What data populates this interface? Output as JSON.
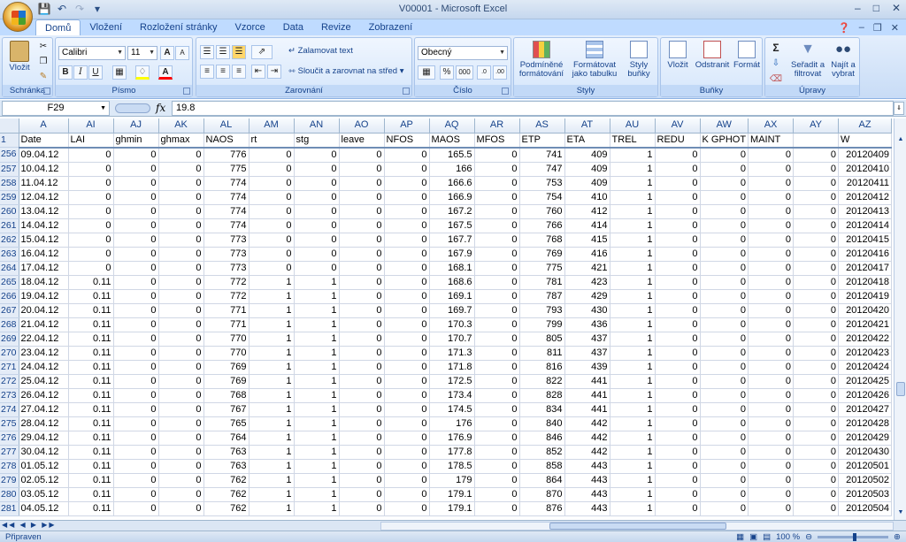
{
  "window": {
    "title": "V00001 - Microsoft Excel"
  },
  "quick_access": {
    "icons": [
      "save-icon",
      "undo-icon",
      "redo-icon",
      "customize-icon"
    ]
  },
  "tabs": [
    {
      "label": "Domů",
      "active": true
    },
    {
      "label": "Vložení"
    },
    {
      "label": "Rozložení stránky"
    },
    {
      "label": "Vzorce"
    },
    {
      "label": "Data"
    },
    {
      "label": "Revize"
    },
    {
      "label": "Zobrazení"
    }
  ],
  "ribbon": {
    "clipboard": {
      "label": "Schránka",
      "paste": "Vložit"
    },
    "font": {
      "label": "Písmo",
      "name": "Calibri",
      "size": "11",
      "bold": "B",
      "italic": "I",
      "underline": "U",
      "grow": "A",
      "shrink": "A"
    },
    "alignment": {
      "label": "Zarovnání",
      "wrap": "Zalamovat text",
      "merge": "Sloučit a zarovnat na střed"
    },
    "number": {
      "label": "Číslo",
      "format": "Obecný",
      "percent": "%",
      "thousands": "000"
    },
    "styles": {
      "label": "Styly",
      "conditional": "Podmíněné formátování",
      "as_table": "Formátovat jako tabulku",
      "cell_styles": "Styly buňky"
    },
    "cells": {
      "label": "Buňky",
      "insert": "Vložit",
      "delete": "Odstranit",
      "format": "Formát"
    },
    "editing": {
      "label": "Úpravy",
      "sigma": "Σ",
      "sort": "Seřadit a filtrovat",
      "find": "Najít a vybrat"
    }
  },
  "formula_bar": {
    "name_box": "F29",
    "fx": "fx",
    "value": "19.8"
  },
  "columns": [
    "A",
    "AI",
    "AJ",
    "AK",
    "AL",
    "AM",
    "AN",
    "AO",
    "AP",
    "AQ",
    "AR",
    "AS",
    "AT",
    "AU",
    "AV",
    "AW",
    "AX",
    "AY",
    "AZ"
  ],
  "header_row": {
    "num": "1",
    "cells": [
      "Date",
      "LAI",
      "ghmin",
      "ghmax",
      "NAOS",
      "rt",
      "stg",
      "leave",
      "NFOS",
      "MAOS",
      "MFOS",
      "ETP",
      "ETA",
      "TREL",
      "REDU",
      "K GPHOT",
      "MAINT",
      "",
      "W"
    ]
  },
  "rows": [
    {
      "num": "256",
      "cells": [
        "09.04.12",
        "0",
        "0",
        "0",
        "776",
        "0",
        "0",
        "0",
        "0",
        "165.5",
        "0",
        "741",
        "409",
        "1",
        "0",
        "0",
        "0",
        "0",
        "20120409"
      ]
    },
    {
      "num": "257",
      "cells": [
        "10.04.12",
        "0",
        "0",
        "0",
        "775",
        "0",
        "0",
        "0",
        "0",
        "166",
        "0",
        "747",
        "409",
        "1",
        "0",
        "0",
        "0",
        "0",
        "20120410"
      ]
    },
    {
      "num": "258",
      "cells": [
        "11.04.12",
        "0",
        "0",
        "0",
        "774",
        "0",
        "0",
        "0",
        "0",
        "166.6",
        "0",
        "753",
        "409",
        "1",
        "0",
        "0",
        "0",
        "0",
        "20120411"
      ]
    },
    {
      "num": "259",
      "cells": [
        "12.04.12",
        "0",
        "0",
        "0",
        "774",
        "0",
        "0",
        "0",
        "0",
        "166.9",
        "0",
        "754",
        "410",
        "1",
        "0",
        "0",
        "0",
        "0",
        "20120412"
      ]
    },
    {
      "num": "260",
      "cells": [
        "13.04.12",
        "0",
        "0",
        "0",
        "774",
        "0",
        "0",
        "0",
        "0",
        "167.2",
        "0",
        "760",
        "412",
        "1",
        "0",
        "0",
        "0",
        "0",
        "20120413"
      ]
    },
    {
      "num": "261",
      "cells": [
        "14.04.12",
        "0",
        "0",
        "0",
        "774",
        "0",
        "0",
        "0",
        "0",
        "167.5",
        "0",
        "766",
        "414",
        "1",
        "0",
        "0",
        "0",
        "0",
        "20120414"
      ]
    },
    {
      "num": "262",
      "cells": [
        "15.04.12",
        "0",
        "0",
        "0",
        "773",
        "0",
        "0",
        "0",
        "0",
        "167.7",
        "0",
        "768",
        "415",
        "1",
        "0",
        "0",
        "0",
        "0",
        "20120415"
      ]
    },
    {
      "num": "263",
      "cells": [
        "16.04.12",
        "0",
        "0",
        "0",
        "773",
        "0",
        "0",
        "0",
        "0",
        "167.9",
        "0",
        "769",
        "416",
        "1",
        "0",
        "0",
        "0",
        "0",
        "20120416"
      ]
    },
    {
      "num": "264",
      "cells": [
        "17.04.12",
        "0",
        "0",
        "0",
        "773",
        "0",
        "0",
        "0",
        "0",
        "168.1",
        "0",
        "775",
        "421",
        "1",
        "0",
        "0",
        "0",
        "0",
        "20120417"
      ]
    },
    {
      "num": "265",
      "cells": [
        "18.04.12",
        "0.11",
        "0",
        "0",
        "772",
        "1",
        "1",
        "0",
        "0",
        "168.6",
        "0",
        "781",
        "423",
        "1",
        "0",
        "0",
        "0",
        "0",
        "20120418"
      ]
    },
    {
      "num": "266",
      "cells": [
        "19.04.12",
        "0.11",
        "0",
        "0",
        "772",
        "1",
        "1",
        "0",
        "0",
        "169.1",
        "0",
        "787",
        "429",
        "1",
        "0",
        "0",
        "0",
        "0",
        "20120419"
      ]
    },
    {
      "num": "267",
      "cells": [
        "20.04.12",
        "0.11",
        "0",
        "0",
        "771",
        "1",
        "1",
        "0",
        "0",
        "169.7",
        "0",
        "793",
        "430",
        "1",
        "0",
        "0",
        "0",
        "0",
        "20120420"
      ]
    },
    {
      "num": "268",
      "cells": [
        "21.04.12",
        "0.11",
        "0",
        "0",
        "771",
        "1",
        "1",
        "0",
        "0",
        "170.3",
        "0",
        "799",
        "436",
        "1",
        "0",
        "0",
        "0",
        "0",
        "20120421"
      ]
    },
    {
      "num": "269",
      "cells": [
        "22.04.12",
        "0.11",
        "0",
        "0",
        "770",
        "1",
        "1",
        "0",
        "0",
        "170.7",
        "0",
        "805",
        "437",
        "1",
        "0",
        "0",
        "0",
        "0",
        "20120422"
      ]
    },
    {
      "num": "270",
      "cells": [
        "23.04.12",
        "0.11",
        "0",
        "0",
        "770",
        "1",
        "1",
        "0",
        "0",
        "171.3",
        "0",
        "811",
        "437",
        "1",
        "0",
        "0",
        "0",
        "0",
        "20120423"
      ]
    },
    {
      "num": "271",
      "cells": [
        "24.04.12",
        "0.11",
        "0",
        "0",
        "769",
        "1",
        "1",
        "0",
        "0",
        "171.8",
        "0",
        "816",
        "439",
        "1",
        "0",
        "0",
        "0",
        "0",
        "20120424"
      ]
    },
    {
      "num": "272",
      "cells": [
        "25.04.12",
        "0.11",
        "0",
        "0",
        "769",
        "1",
        "1",
        "0",
        "0",
        "172.5",
        "0",
        "822",
        "441",
        "1",
        "0",
        "0",
        "0",
        "0",
        "20120425"
      ]
    },
    {
      "num": "273",
      "cells": [
        "26.04.12",
        "0.11",
        "0",
        "0",
        "768",
        "1",
        "1",
        "0",
        "0",
        "173.4",
        "0",
        "828",
        "441",
        "1",
        "0",
        "0",
        "0",
        "0",
        "20120426"
      ]
    },
    {
      "num": "274",
      "cells": [
        "27.04.12",
        "0.11",
        "0",
        "0",
        "767",
        "1",
        "1",
        "0",
        "0",
        "174.5",
        "0",
        "834",
        "441",
        "1",
        "0",
        "0",
        "0",
        "0",
        "20120427"
      ]
    },
    {
      "num": "275",
      "cells": [
        "28.04.12",
        "0.11",
        "0",
        "0",
        "765",
        "1",
        "1",
        "0",
        "0",
        "176",
        "0",
        "840",
        "442",
        "1",
        "0",
        "0",
        "0",
        "0",
        "20120428"
      ]
    },
    {
      "num": "276",
      "cells": [
        "29.04.12",
        "0.11",
        "0",
        "0",
        "764",
        "1",
        "1",
        "0",
        "0",
        "176.9",
        "0",
        "846",
        "442",
        "1",
        "0",
        "0",
        "0",
        "0",
        "20120429"
      ]
    },
    {
      "num": "277",
      "cells": [
        "30.04.12",
        "0.11",
        "0",
        "0",
        "763",
        "1",
        "1",
        "0",
        "0",
        "177.8",
        "0",
        "852",
        "442",
        "1",
        "0",
        "0",
        "0",
        "0",
        "20120430"
      ]
    },
    {
      "num": "278",
      "cells": [
        "01.05.12",
        "0.11",
        "0",
        "0",
        "763",
        "1",
        "1",
        "0",
        "0",
        "178.5",
        "0",
        "858",
        "443",
        "1",
        "0",
        "0",
        "0",
        "0",
        "20120501"
      ]
    },
    {
      "num": "279",
      "cells": [
        "02.05.12",
        "0.11",
        "0",
        "0",
        "762",
        "1",
        "1",
        "0",
        "0",
        "179",
        "0",
        "864",
        "443",
        "1",
        "0",
        "0",
        "0",
        "0",
        "20120502"
      ]
    },
    {
      "num": "280",
      "cells": [
        "03.05.12",
        "0.11",
        "0",
        "0",
        "762",
        "1",
        "1",
        "0",
        "0",
        "179.1",
        "0",
        "870",
        "443",
        "1",
        "0",
        "0",
        "0",
        "0",
        "20120503"
      ]
    },
    {
      "num": "281",
      "cells": [
        "04.05.12",
        "0.11",
        "0",
        "0",
        "762",
        "1",
        "1",
        "0",
        "0",
        "179.1",
        "0",
        "876",
        "443",
        "1",
        "0",
        "0",
        "0",
        "0",
        "20120504"
      ]
    }
  ],
  "status": {
    "text": "Připraven",
    "zoom": "100 %"
  }
}
